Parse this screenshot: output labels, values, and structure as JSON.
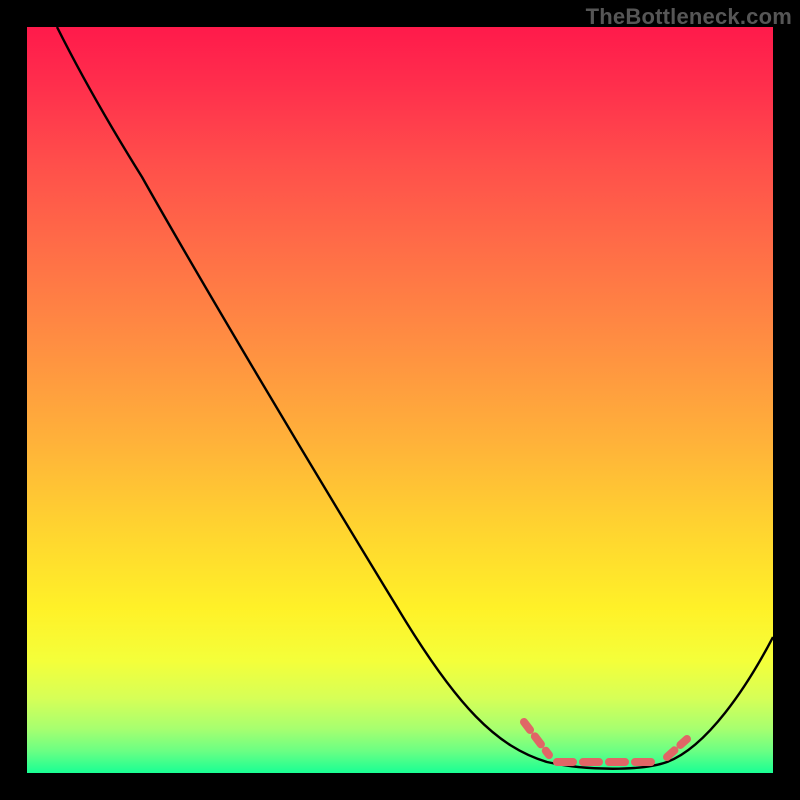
{
  "attribution": "TheBottleneck.com",
  "colors": {
    "frame_background": "#000000",
    "gradient_top": "#ff1a4b",
    "gradient_bottom": "#19ff94",
    "curve": "#000000",
    "marker": "#e06666",
    "attribution_text": "#565656"
  },
  "chart_data": {
    "type": "line",
    "title": "",
    "xlabel": "",
    "ylabel": "",
    "xlim": [
      0,
      100
    ],
    "ylim": [
      0,
      100
    ],
    "grid": false,
    "legend": false,
    "series": [
      {
        "name": "bottleneck_curve",
        "x": [
          4,
          10,
          15,
          20,
          30,
          40,
          50,
          60,
          65,
          70,
          75,
          80,
          85,
          90,
          95,
          100
        ],
        "values": [
          100,
          90,
          80,
          72,
          56,
          40,
          22,
          10,
          6,
          2,
          1,
          1,
          2,
          4,
          10,
          18
        ]
      }
    ],
    "annotations": [
      {
        "name": "optimal_range_marker",
        "style": "dashed",
        "color": "#e06666",
        "x_range": [
          67,
          88
        ],
        "y_approx": 1
      }
    ],
    "background": {
      "type": "vertical_gradient",
      "meaning": "red_high_to_green_low",
      "stops": [
        {
          "pos": 0.0,
          "color": "#ff1a4b"
        },
        {
          "pos": 0.3,
          "color": "#ff6e47"
        },
        {
          "pos": 0.67,
          "color": "#ffd330"
        },
        {
          "pos": 0.85,
          "color": "#f4ff3a"
        },
        {
          "pos": 1.0,
          "color": "#19ff94"
        }
      ]
    }
  }
}
